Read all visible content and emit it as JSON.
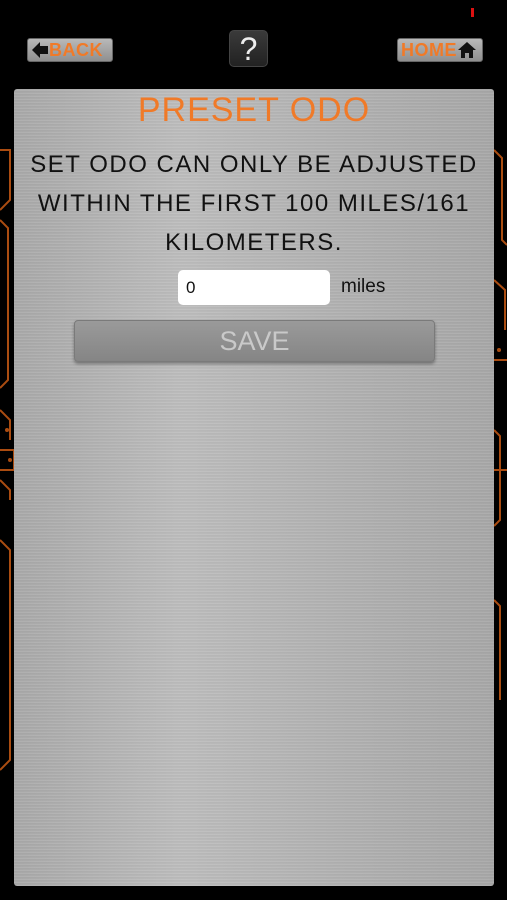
{
  "header": {
    "back_label": "BACK",
    "help_label": "?",
    "home_label": "HOME"
  },
  "panel": {
    "title": "PRESET ODO",
    "description_lines": [
      "SET ODO CAN ONLY BE ADJUSTED",
      "WITHIN THE FIRST 100 MILES/161",
      "KILOMETERS."
    ],
    "odo_value": "0",
    "unit_label": "miles",
    "save_label": "SAVE"
  },
  "colors": {
    "accent": "#f07a28",
    "background": "#000000",
    "panel": "#b4b4b4"
  },
  "icons": {
    "back": "arrow-left-icon",
    "home": "house-icon"
  }
}
